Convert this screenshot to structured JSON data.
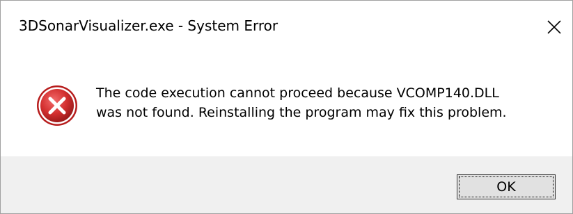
{
  "window": {
    "title": "3DSonarVisualizer.exe - System Error"
  },
  "icons": {
    "error": "error-icon",
    "close": "close-icon"
  },
  "message": {
    "line1": "The code execution cannot proceed because VCOMP140.DLL",
    "line2": "was not found. Reinstalling the program may fix this problem."
  },
  "buttons": {
    "ok_label": "OK"
  },
  "colors": {
    "error_red": "#d32f2f",
    "footer_bg": "#f0f0f0"
  }
}
